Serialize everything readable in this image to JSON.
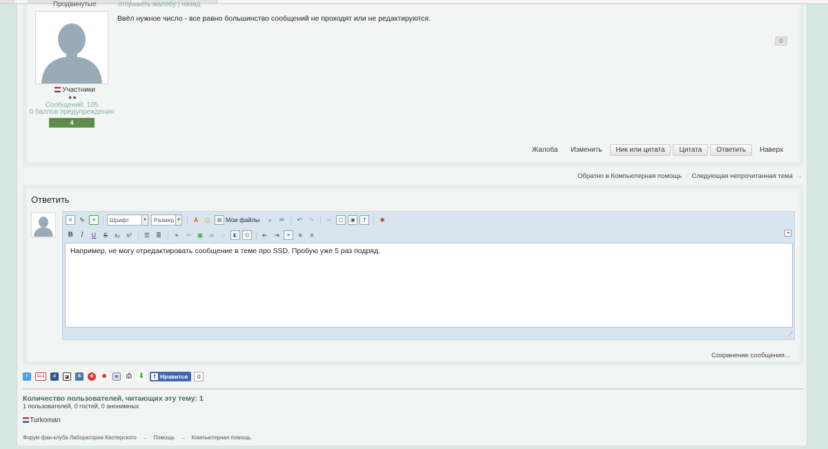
{
  "post": {
    "author_cut": "Продвинутые",
    "link_cut": "отправить жалобу | назад",
    "group": "Участники",
    "pips": "●●",
    "messages": "Сообщений: 105",
    "warnings": "0 баллов предупреждения",
    "reputation": "4",
    "text": "Ввёл нужное число - все равно большинство сообщений не проходят или не редактируются.",
    "like_count": "0",
    "actions": {
      "report": "Жалоба",
      "edit": "Изменить",
      "nick_quote": "Ник или цитата",
      "quote": "Цитата",
      "reply": "Ответить",
      "top": "Наверх"
    }
  },
  "nav": {
    "back": "Обратно в Компьютерная помощь",
    "sep": "·",
    "next": "Следующая непрочитанная тема",
    "arrow": "→"
  },
  "reply": {
    "title": "Ответить",
    "font_placeholder": "Шрифт",
    "size_placeholder": "Размер",
    "my_files": "Мои файлы",
    "content": "Например, не могу отредактировать сообщение в теме про SSD. Пробую уже 5 раз подряд.",
    "saving": "Сохранение сообщения..."
  },
  "share": {
    "gplus": "G+1",
    "fb_like": "Нравится",
    "fb_count": "0"
  },
  "readers": {
    "title": "Количество пользователей, читающих эту тему: 1",
    "sub": "1 пользователей, 0 гостей, 0 анонимных",
    "user": "Turkoman"
  },
  "breadcrumbs": [
    "Форум фан-клуба Лаборатории Касперского",
    "Помощь",
    "Компьютерная помощь"
  ],
  "breadcrumb_arrow": "→",
  "colors": {
    "background": "#d6e7e1",
    "accent": "#7fb3a4",
    "reputation": "#5e8c4a",
    "facebook": "#4267b2"
  }
}
